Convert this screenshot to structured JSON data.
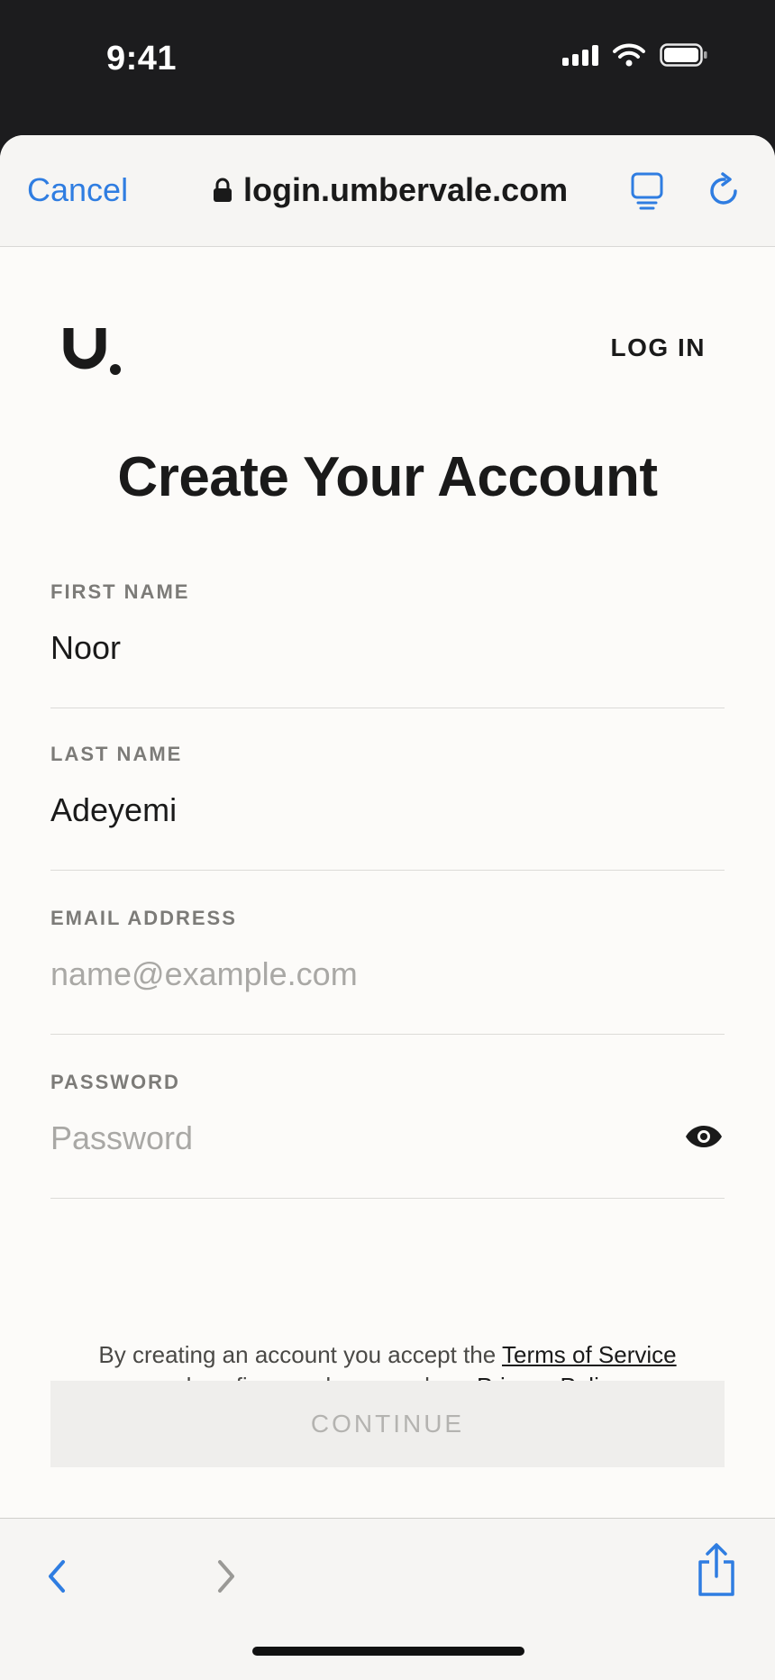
{
  "status_bar": {
    "time": "9:41"
  },
  "browser": {
    "cancel_label": "Cancel",
    "url": "login.umbervale.com"
  },
  "header": {
    "logo_text": "U.",
    "login_label": "LOG IN"
  },
  "main": {
    "title": "Create Your Account",
    "fields": [
      {
        "label": "FIRST NAME",
        "value": "Noor",
        "placeholder": ""
      },
      {
        "label": "LAST NAME",
        "value": "Adeyemi",
        "placeholder": ""
      },
      {
        "label": "EMAIL ADDRESS",
        "value": "",
        "placeholder": "name@example.com"
      },
      {
        "label": "PASSWORD",
        "value": "",
        "placeholder": "Password"
      }
    ],
    "legal": {
      "prefix": "By creating an account you accept the",
      "terms_label": "Terms of Service",
      "middle": "and confirm you have read our",
      "privacy_label": "Privacy Policy"
    },
    "continue_label": "CONTINUE"
  },
  "colors": {
    "accent": "#2f7de1",
    "page_background": "#fcfbf9",
    "text": "#1a1a1a"
  },
  "icons": [
    "lock-icon",
    "reader-icon",
    "reload-icon",
    "eye-icon",
    "back-icon",
    "forward-icon",
    "share-icon"
  ]
}
